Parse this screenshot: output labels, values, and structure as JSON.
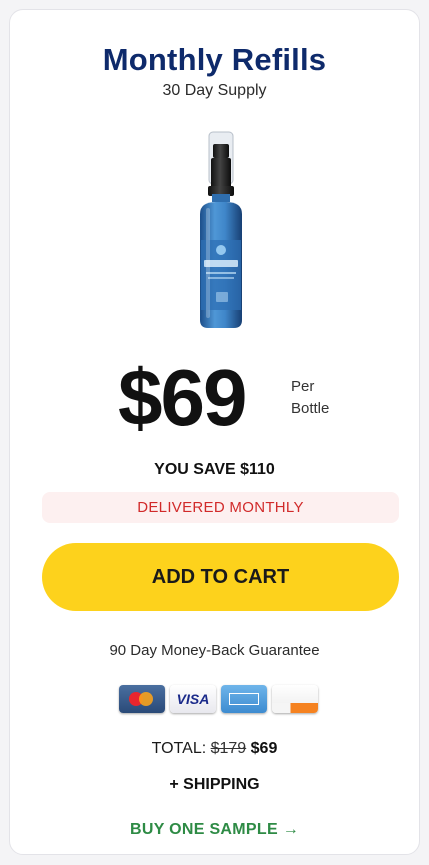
{
  "offer": {
    "title": "Monthly Refills",
    "subtitle": "30 Day Supply",
    "product_image": "neuroquiet-spray-bottle-image",
    "price": "$69",
    "price_unit_line1": "Per",
    "price_unit_line2": "Bottle",
    "savings": "YOU SAVE $110",
    "delivery_badge": "DELIVERED MONTHLY",
    "cta_label": "ADD TO CART",
    "guarantee": "90 Day Money-Back Guarantee",
    "payment_icons": [
      "mastercard-icon",
      "visa-icon",
      "amex-icon",
      "discover-icon"
    ],
    "visa_text": "VISA",
    "total_label": "TOTAL:",
    "total_old": "$179",
    "total_new": "$69",
    "shipping": "+ SHIPPING",
    "sample_link": "BUY ONE SAMPLE",
    "sample_arrow": "→"
  },
  "colors": {
    "title": "#0e2a6b",
    "cta_background": "#fdd21c",
    "delivery_text": "#d12a2a",
    "delivery_background": "#fdf0f0",
    "sample_link": "#2e8b45"
  }
}
